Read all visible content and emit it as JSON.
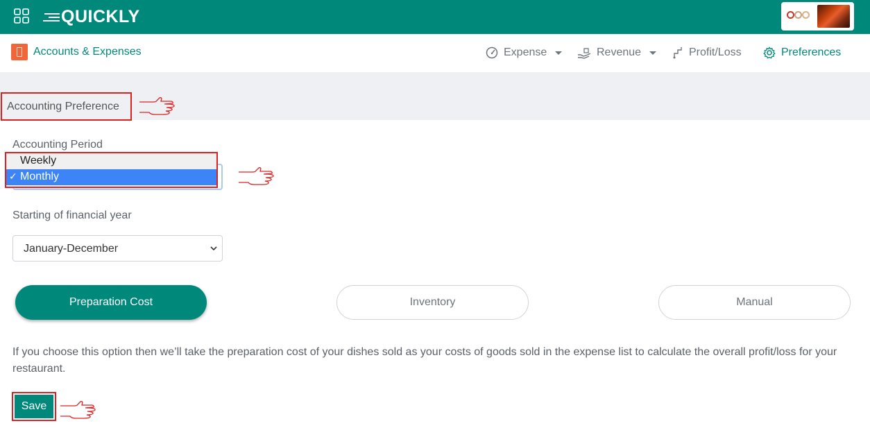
{
  "topbar": {
    "app_name": "QUICKLY",
    "brand_color": "#00897b"
  },
  "subnav": {
    "section_title": "Accounts & Expenses",
    "items": [
      {
        "label": "Expense",
        "icon": "gauge-icon",
        "has_caret": true
      },
      {
        "label": "Revenue",
        "icon": "hand-money-icon",
        "has_caret": true
      },
      {
        "label": "Profit/Loss",
        "icon": "trend-icon",
        "has_caret": false
      },
      {
        "label": "Preferences",
        "icon": "gear-icon",
        "has_caret": false,
        "active": true
      }
    ]
  },
  "page": {
    "heading": "Accounting Preference",
    "accounting_period": {
      "label": "Accounting Period",
      "options": [
        "Weekly",
        "Monthly"
      ],
      "selected": "Monthly",
      "check_mark": "✓"
    },
    "financial_year": {
      "label": "Starting of financial year",
      "value": "January-December"
    },
    "cost_modes": [
      {
        "label": "Preparation Cost",
        "selected": true
      },
      {
        "label": "Inventory",
        "selected": false
      },
      {
        "label": "Manual",
        "selected": false
      }
    ],
    "description": "If you choose this option then we’ll take the preparation cost of your dishes sold as your costs of goods sold in the expense list to calculate the overall profit/loss for your restaurant.",
    "save_label": "Save"
  },
  "annotation": {
    "highlight_color": "#e02020",
    "pointer_icon": "pointing-hand-icon"
  }
}
